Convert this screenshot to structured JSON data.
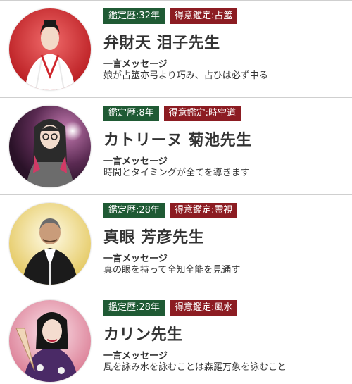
{
  "fortune_tellers": [
    {
      "experience": "鑑定歴:32年",
      "specialty": "得意鑑定:占筮",
      "name": "弁財天 泪子先生",
      "message_label": "一言メッセージ",
      "message": "娘が占筮亦弓より巧み、占ひは必ず中る",
      "avatar": "portrait-red-background-shrine-robe",
      "badge_colors": {
        "experience": "#1f5a34",
        "specialty": "#8c1c22"
      }
    },
    {
      "experience": "鑑定歴:8年",
      "specialty": "得意鑑定:時空道",
      "name": "カトリーヌ 菊池先生",
      "message_label": "一言メッセージ",
      "message": "時間とタイミングが全てを導きます",
      "avatar": "portrait-purple-background-glasses",
      "badge_colors": {
        "experience": "#1f5a34",
        "specialty": "#8c1c22"
      }
    },
    {
      "experience": "鑑定歴:28年",
      "specialty": "得意鑑定:霊視",
      "name": "真眼 芳彦先生",
      "message_label": "一言メッセージ",
      "message": "真の眼を持って全知全能を見通す",
      "avatar": "portrait-gold-background-kimono",
      "badge_colors": {
        "experience": "#1f5a34",
        "specialty": "#8c1c22"
      }
    },
    {
      "experience": "鑑定歴:28年",
      "specialty": "得意鑑定:風水",
      "name": "カリン先生",
      "message_label": "一言メッセージ",
      "message": "風を詠み水を詠むことは森羅万象を詠むこと",
      "avatar": "portrait-pink-background-fan",
      "badge_colors": {
        "experience": "#1f5a34",
        "specialty": "#8c1c22"
      }
    }
  ]
}
